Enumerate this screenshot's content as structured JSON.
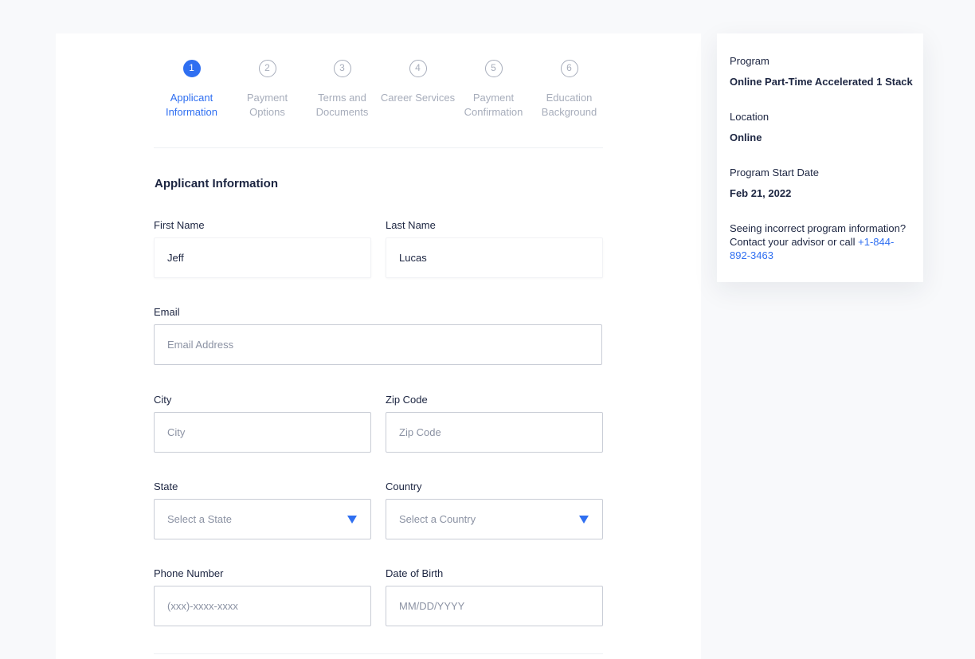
{
  "steps": [
    {
      "number": "1",
      "label": "Applicant Information",
      "active": true
    },
    {
      "number": "2",
      "label": "Payment Options",
      "active": false
    },
    {
      "number": "3",
      "label": "Terms and Documents",
      "active": false
    },
    {
      "number": "4",
      "label": "Career Services",
      "active": false
    },
    {
      "number": "5",
      "label": "Payment Confirmation",
      "active": false
    },
    {
      "number": "6",
      "label": "Education Background",
      "active": false
    }
  ],
  "form": {
    "title": "Applicant Information",
    "first_name": {
      "label": "First Name",
      "value": "Jeff"
    },
    "last_name": {
      "label": "Last Name",
      "value": "Lucas"
    },
    "email": {
      "label": "Email",
      "placeholder": "Email Address"
    },
    "city": {
      "label": "City",
      "placeholder": "City"
    },
    "zip": {
      "label": "Zip Code",
      "placeholder": "Zip Code"
    },
    "state": {
      "label": "State",
      "placeholder": "Select a State"
    },
    "country": {
      "label": "Country",
      "placeholder": "Select a Country"
    },
    "phone": {
      "label": "Phone Number",
      "placeholder": "(xxx)-xxxx-xxxx"
    },
    "dob": {
      "label": "Date of Birth",
      "placeholder": "MM/DD/YYYY"
    }
  },
  "summary": {
    "program_label": "Program",
    "program_value": "Online Part-Time Accelerated 1 Stack",
    "location_label": "Location",
    "location_value": "Online",
    "start_label": "Program Start Date",
    "start_value": "Feb 21, 2022",
    "note_text": "Seeing incorrect program information? Contact your advisor or call ",
    "note_phone": "+1-844-892-3463"
  },
  "colors": {
    "accent": "#2f6ff1",
    "text": "#1c2541",
    "muted": "#a7adbb"
  },
  "icons": {
    "dropdown": "triangle-down-icon"
  }
}
